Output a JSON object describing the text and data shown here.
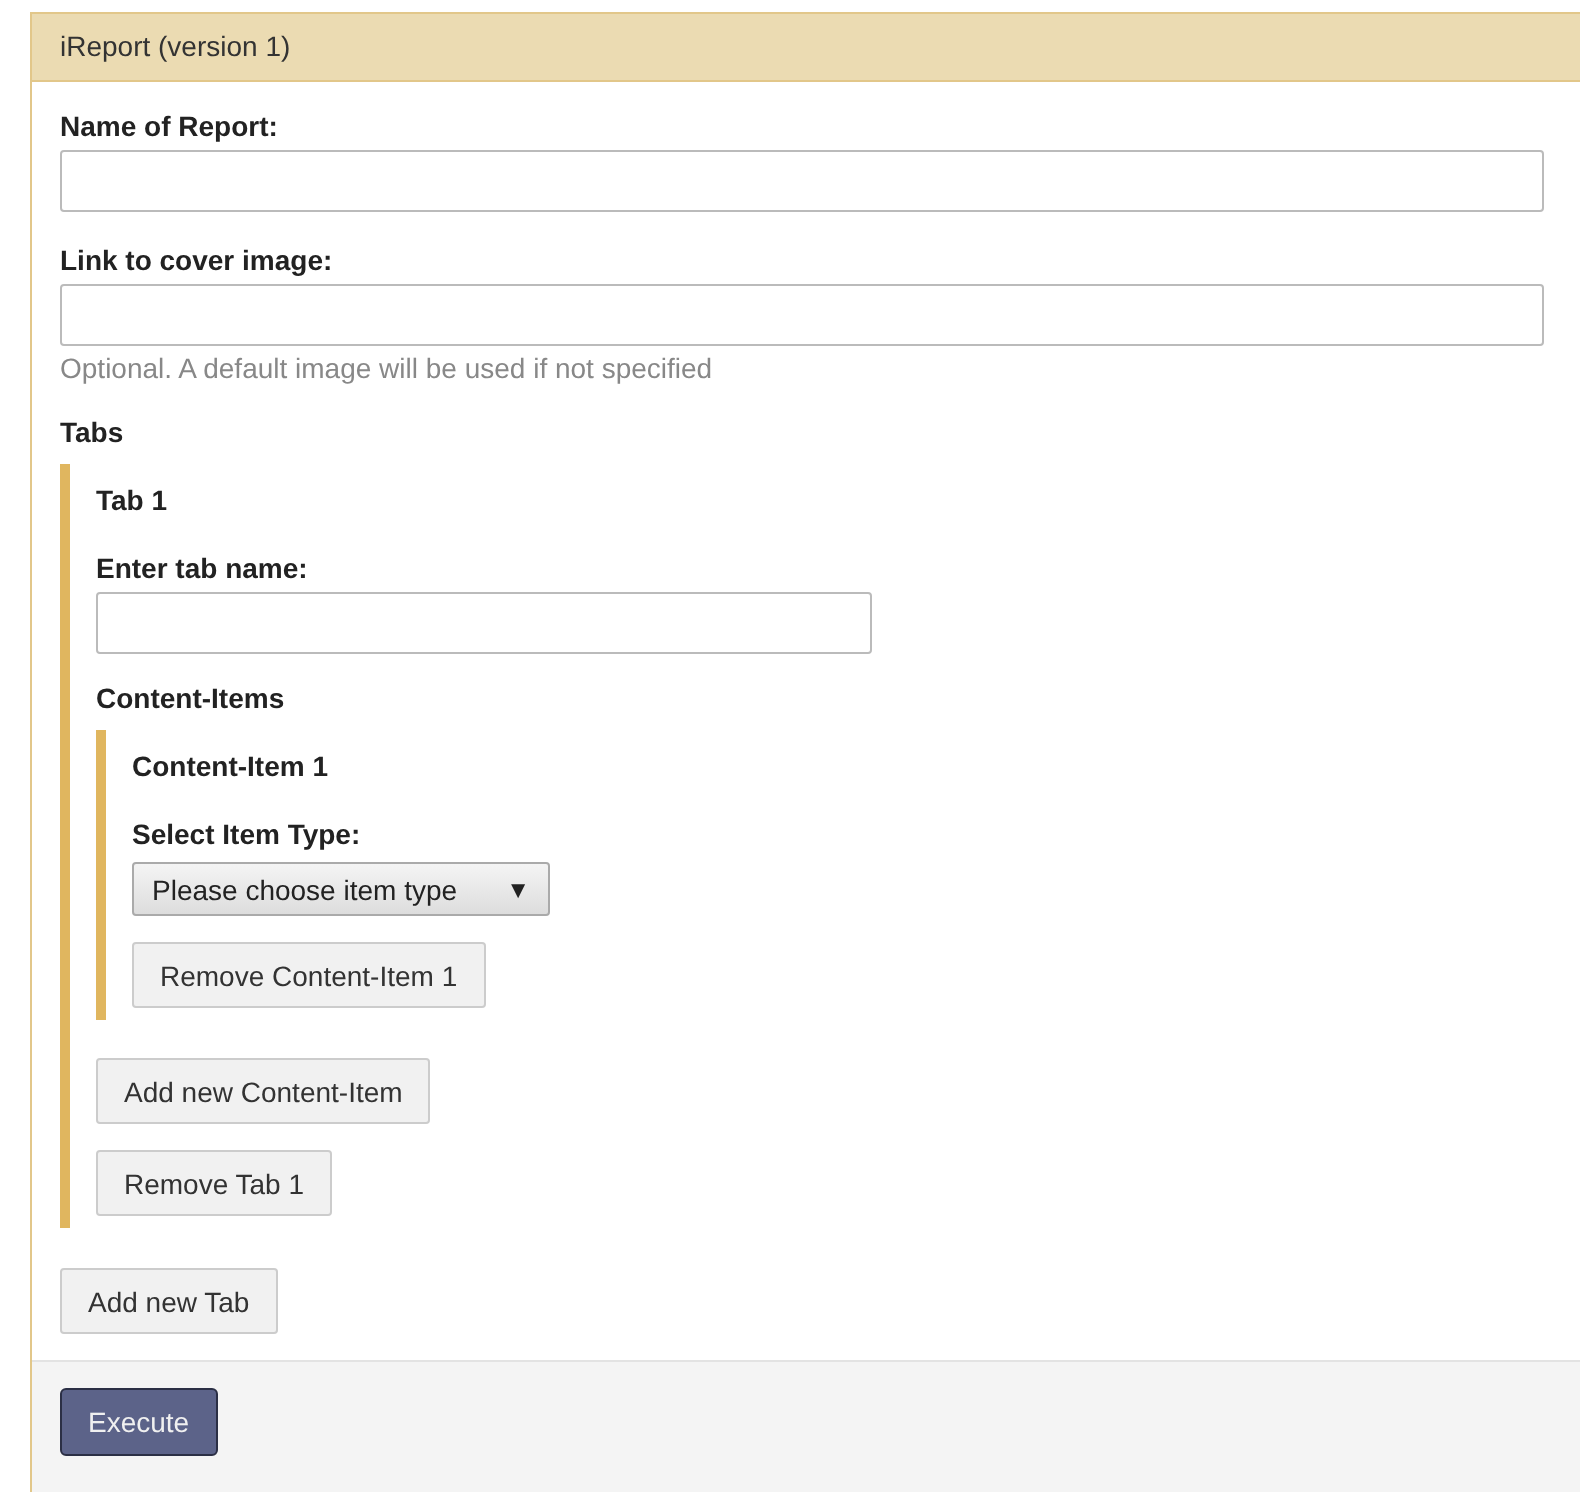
{
  "panel": {
    "title": "iReport (version 1)"
  },
  "fields": [
    {
      "label": "Name of Report:"
    },
    {
      "label": "Link to cover image:",
      "hint": "Optional. A default image will be used if not specified"
    }
  ],
  "tabs_heading": "Tabs",
  "tabs": [
    {
      "title": "Tab 1",
      "name_label": "Enter tab name:",
      "content_heading": "Content-Items",
      "items": [
        {
          "title": "Content-Item 1",
          "select_label": "Select Item Type:",
          "select_value": "Please choose item type",
          "select_arrow": "▼",
          "remove_button": "Remove Content-Item 1"
        }
      ],
      "add_item_button": "Add new Content-Item",
      "remove_button": "Remove Tab 1"
    }
  ],
  "add_tab_button": "Add new Tab",
  "execute_button": "Execute"
}
